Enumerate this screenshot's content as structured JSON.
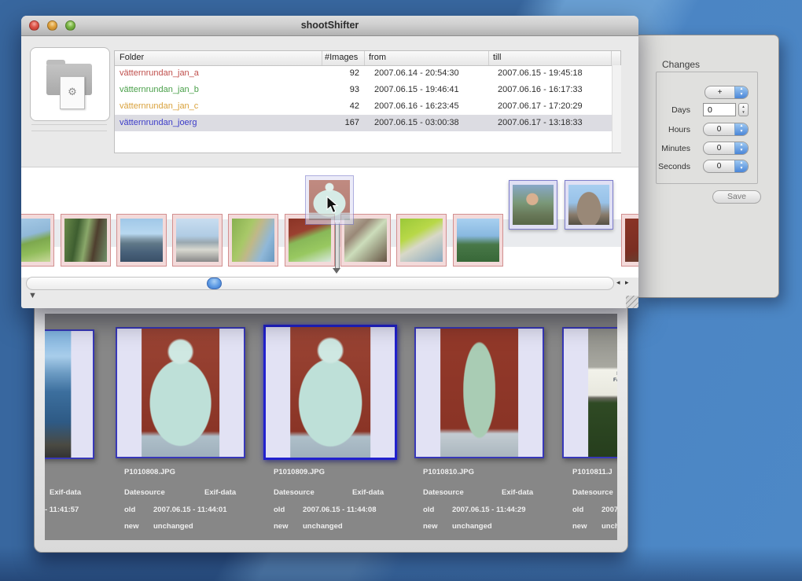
{
  "window": {
    "title": "shootShifter"
  },
  "table": {
    "headers": {
      "folder": "Folder",
      "images": "#Images",
      "from": "from",
      "till": "till"
    },
    "rows": [
      {
        "name": "vätternrundan_jan_a",
        "count": "92",
        "from": "2007.06.14 - 20:54:30",
        "till": "2007.06.15 - 19:45:18",
        "color": "#c0504d"
      },
      {
        "name": "vätternrundan_jan_b",
        "count": "93",
        "from": "2007.06.15 - 19:46:41",
        "till": "2007.06.16 - 16:17:33",
        "color": "#4aa04a"
      },
      {
        "name": "vätternrundan_jan_c",
        "count": "42",
        "from": "2007.06.16 - 16:23:45",
        "till": "2007.06.17 - 17:20:29",
        "color": "#d9a23d"
      },
      {
        "name": "vätternrundan_joerg",
        "count": "167",
        "from": "2007.06.15 - 03:00:38",
        "till": "2007.06.17 - 13:18:33",
        "color": "#3b3bc8"
      }
    ]
  },
  "changes": {
    "title": "Changes",
    "sign_value": "+",
    "days_label": "Days",
    "days_value": "0",
    "hours_label": "Hours",
    "hours_value": "0",
    "minutes_label": "Minutes",
    "minutes_value": "0",
    "seconds_label": "Seconds",
    "seconds_value": "0",
    "save_label": "Save"
  },
  "photo_panel": {
    "labels": {
      "datesource": "Datesource",
      "exif": "Exif-data",
      "old": "old",
      "new": "new"
    },
    "items": [
      {
        "filename": "",
        "old_value": "- 11:41:57",
        "new_value": ""
      },
      {
        "filename": "P1010808.JPG",
        "old_value": "2007.06.15 - 11:44:01",
        "new_value": "unchanged"
      },
      {
        "filename": "P1010809.JPG",
        "old_value": "2007.06.15 - 11:44:08",
        "new_value": "unchanged"
      },
      {
        "filename": "P1010810.JPG",
        "old_value": "2007.06.15 - 11:44:29",
        "new_value": "unchanged"
      },
      {
        "filename": "P1010811.J",
        "old_value": "2007",
        "new_value": "unch"
      }
    ],
    "sign_photo_text": {
      "line1": "Ester Ap",
      "line2": "Familjelyck"
    }
  },
  "icons": {
    "disclosure": "▼",
    "scroll_left": "◂",
    "scroll_right": "▸",
    "gear": "⚙",
    "popup_up": "▲",
    "popup_down": "▼"
  },
  "colors": {
    "accent_aqua": "#4d90e0",
    "pink_thumb_border": "#d28f8f",
    "blue_thumb_border": "#7d7dcb",
    "selection_blue": "#2121cd"
  }
}
